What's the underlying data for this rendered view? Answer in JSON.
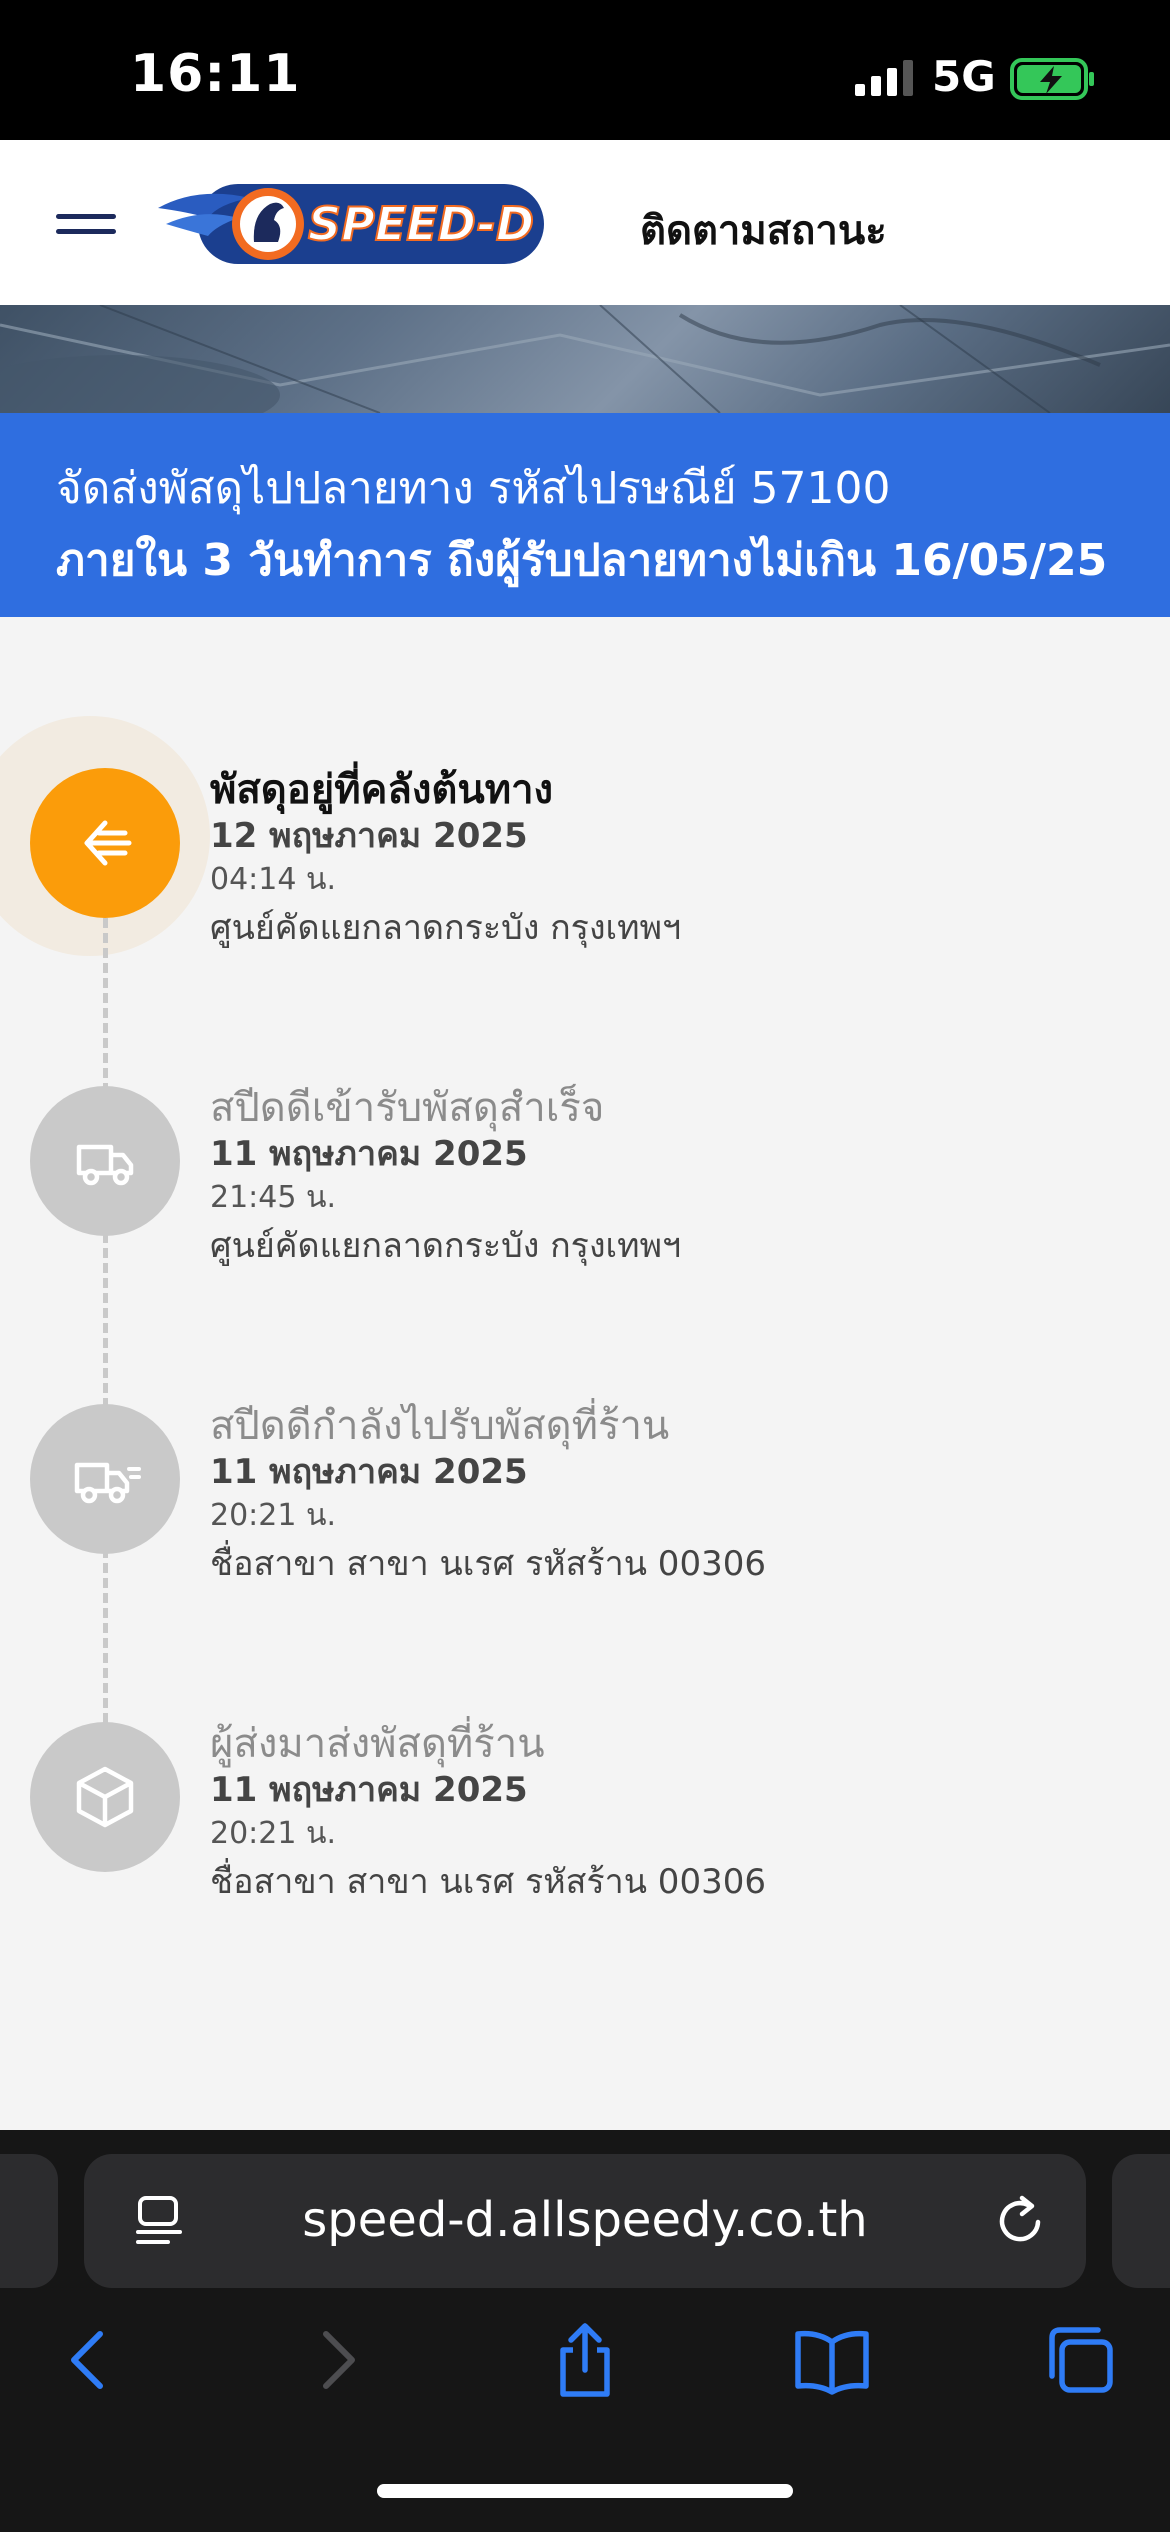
{
  "status_bar": {
    "time": "16:11",
    "network": "5G"
  },
  "header": {
    "title": "ติดตามสถานะ",
    "logo_text": "SPEED-D"
  },
  "banner": {
    "line1": "จัดส่งพัสดุไปปลายทาง รหัสไปรษณีย์ 57100",
    "line2": "ภายใน 3 วันทำการ ถึงผู้รับปลายทางไม่เกิน 16/05/25"
  },
  "timeline": [
    {
      "title": "พัสดุอยู่ที่คลังต้นทาง",
      "date": "12 พฤษภาคม 2025",
      "time": "04:14 น.",
      "place": "ศูนย์คัดแยกลาดกระบัง กรุงเทพฯ",
      "icon": "arrow-left-icon",
      "active": true
    },
    {
      "title": "สปีดดีเข้ารับพัสดุสำเร็จ",
      "date": "11 พฤษภาคม 2025",
      "time": "21:45 น.",
      "place": "ศูนย์คัดแยกลาดกระบัง กรุงเทพฯ",
      "icon": "truck-icon",
      "active": false
    },
    {
      "title": "สปีดดีกำลังไปรับพัสดุที่ร้าน",
      "date": "11 พฤษภาคม 2025",
      "time": "20:21 น.",
      "place": "ชื่อสาขา สาขา นเรศ รหัสร้าน 00306",
      "icon": "fast-truck-icon",
      "active": false
    },
    {
      "title": "ผู้ส่งมาส่งพัสดุที่ร้าน",
      "date": "11 พฤษภาคม 2025",
      "time": "20:21 น.",
      "place": "ชื่อสาขา สาขา นเรศ รหัสร้าน 00306",
      "icon": "package-icon",
      "active": false
    }
  ],
  "browser": {
    "url": "speed-d.allspeedy.co.th"
  },
  "colors": {
    "accent": "#2f6ee0",
    "active_step": "#fb9c0a",
    "inactive_step": "#c9c9c9",
    "brand_navy": "#1c2a5c",
    "brand_orange": "#f26b21"
  }
}
